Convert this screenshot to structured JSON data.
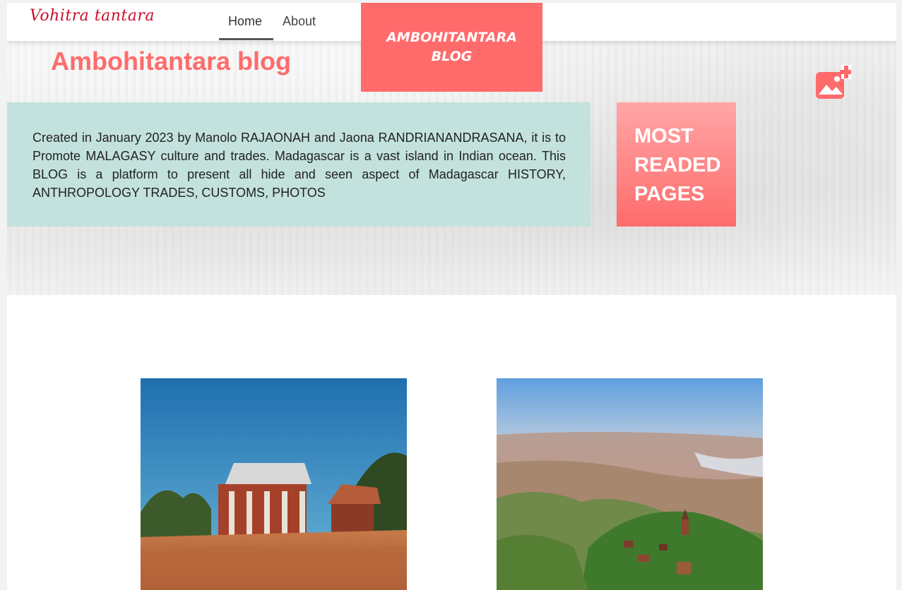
{
  "header": {
    "brand": "Vohitra tantara",
    "nav": [
      {
        "label": "Home",
        "active": true
      },
      {
        "label": "About",
        "active": false
      }
    ],
    "badge_line1": "AMBOHITANTARA",
    "badge_line2": "BLOG"
  },
  "hero": {
    "title": "Ambohitantara blog",
    "intro": "Created in January 2023 by Manolo RAJAONAH and Jaona RANDRIANANDRASANA, it is to Promote MALAGASY culture and trades. Madagascar is a vast island in Indian ocean. This BLOG is a platform to present all hide and seen aspect of Madagascar HISTORY, ANTHROPOLOGY TRADES, CUSTOMS, PHOTOS",
    "most_read_line1": "MOST",
    "most_read_line2": "READED",
    "most_read_line3": "PAGES",
    "add_icon": "add-photo-icon"
  },
  "gallery": {
    "images": [
      "traditional-house-photo",
      "highland-landscape-photo"
    ]
  },
  "colors": {
    "accent": "#ff6b6b",
    "intro_bg": "#c3e2dd",
    "brand": "#c8102e"
  }
}
